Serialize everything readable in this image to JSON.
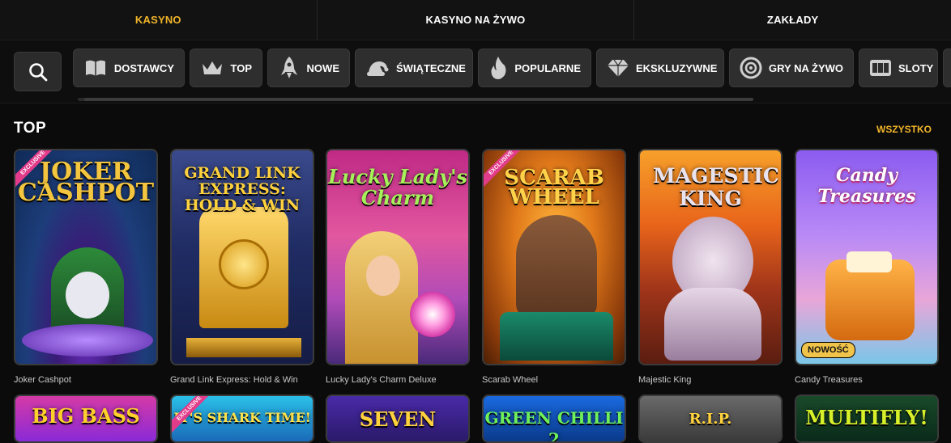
{
  "tabs": [
    {
      "label": "KASYNO",
      "active": true
    },
    {
      "label": "KASYNO NA ŻYWO",
      "active": false
    },
    {
      "label": "ZAKŁADY",
      "active": false
    }
  ],
  "categories": [
    {
      "label": "DOSTAWCY",
      "icon": "book-icon"
    },
    {
      "label": "TOP",
      "icon": "crown-icon"
    },
    {
      "label": "NOWE",
      "icon": "rocket-icon"
    },
    {
      "label": "ŚWIĄTECZNE",
      "icon": "santa-hat-icon"
    },
    {
      "label": "POPULARNE",
      "icon": "flame-icon"
    },
    {
      "label": "EKSKLUZYWNE",
      "icon": "diamond-icon"
    },
    {
      "label": "GRY NA ŻYWO",
      "icon": "roulette-icon"
    },
    {
      "label": "SLOTY",
      "icon": "slot-machine-icon"
    }
  ],
  "section": {
    "title": "TOP",
    "see_all": "WSZYSTKO"
  },
  "games": [
    {
      "name": "Joker Cashpot",
      "art_title": "JOKER CASHPOT",
      "exclusive": "EXCLUSIVE"
    },
    {
      "name": "Grand Link Express: Hold & Win",
      "art_title": "GRAND LINK EXPRESS: HOLD & WIN"
    },
    {
      "name": "Lucky Lady's Charm Deluxe",
      "art_title": "Lucky Lady's Charm"
    },
    {
      "name": "Scarab Wheel",
      "art_title": "SCARAB WHEEL",
      "exclusive": "EXCLUSIVE"
    },
    {
      "name": "Majestic King",
      "art_title": "MAGESTIC KING"
    },
    {
      "name": "Candy Treasures",
      "art_title": "Candy Treasures",
      "badge": "NOWOŚĆ"
    }
  ],
  "games_row2": [
    {
      "art_title": "BIG BASS"
    },
    {
      "art_title": "IT'S SHARK TIME!",
      "exclusive": "EXCLUSIVE"
    },
    {
      "art_title": "SEVEN"
    },
    {
      "art_title": "GREEN CHILLI 2"
    },
    {
      "art_title": "R.I.P."
    },
    {
      "art_title": "MULTIFLY!"
    }
  ],
  "colors": {
    "accent": "#f0b429",
    "background": "#0b0b0b",
    "button": "#2e2e2e"
  }
}
